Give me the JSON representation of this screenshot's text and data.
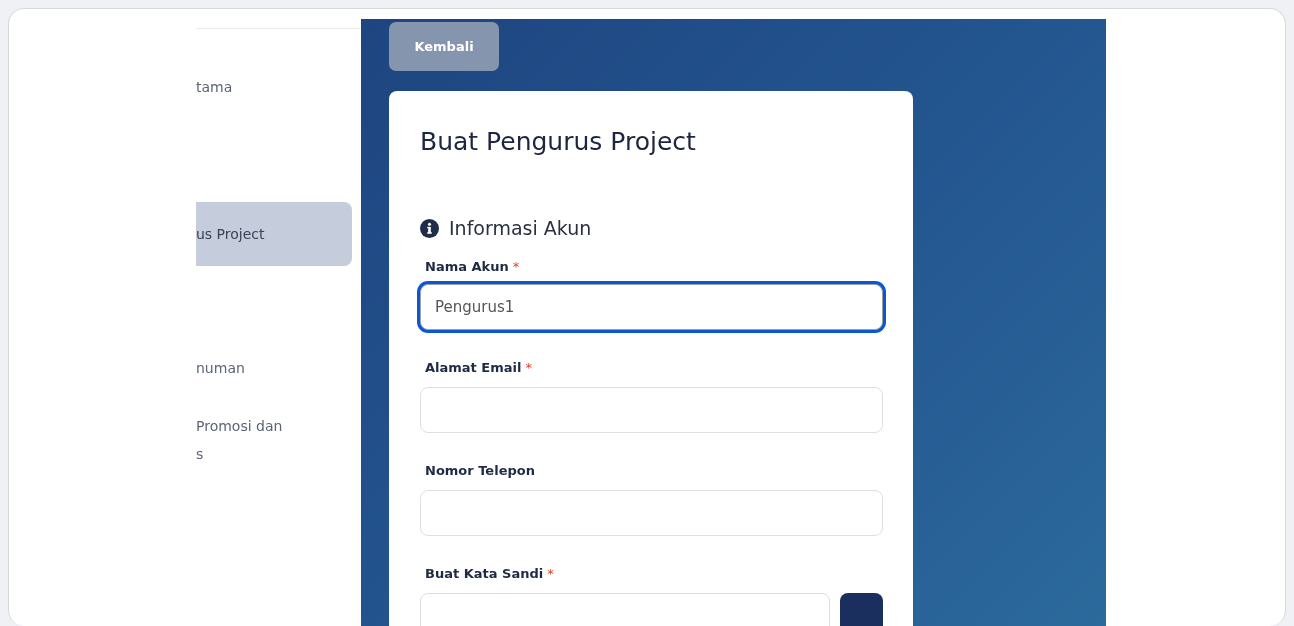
{
  "sidebar": {
    "items": [
      {
        "label": "tama",
        "selected": false
      },
      {
        "label": "us Project",
        "selected": true
      },
      {
        "label": "numan",
        "selected": false
      },
      {
        "label": "Promosi dan\ns",
        "selected": false
      }
    ]
  },
  "back_button": "Kembali",
  "form": {
    "title": "Buat Pengurus Project",
    "section": "Informasi Akun",
    "fields": [
      {
        "kind": "text",
        "label": "Nama Akun",
        "required_mark": "*",
        "value": "Pengurus1",
        "focused": true
      },
      {
        "kind": "text",
        "label": "Alamat Email",
        "required_mark": "*",
        "focused": false
      },
      {
        "kind": "text",
        "label": "Nomor Telepon",
        "focused": false
      },
      {
        "kind": "password",
        "label": "Buat Kata Sandi",
        "required_mark": "*",
        "focused": false
      }
    ]
  }
}
